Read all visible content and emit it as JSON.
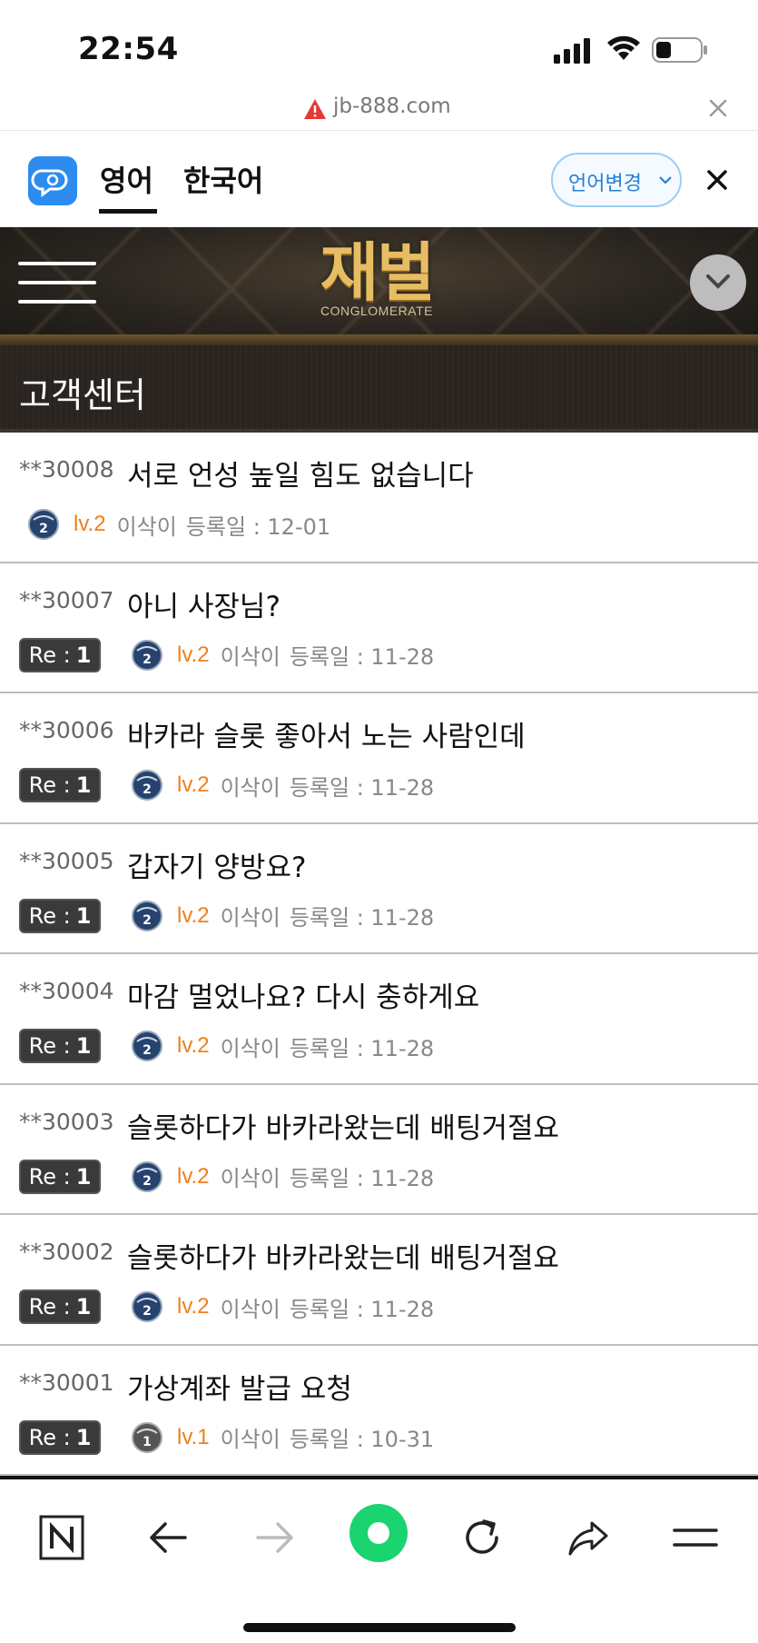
{
  "status_bar": {
    "time": "22:54"
  },
  "url_bar": {
    "domain": "jb-888.com"
  },
  "translate_bar": {
    "tab_active": "영어",
    "tab_inactive": "한국어",
    "change_language": "언어변경"
  },
  "header": {
    "logo_title": "재벌",
    "logo_subtitle": "CONGLOMERATE"
  },
  "page": {
    "title": "고객센터"
  },
  "posts": [
    {
      "id": "**30008",
      "title": "서로 언성 높일 힘도 없습니다",
      "reply": null,
      "level": "lv.2",
      "author": "이삭이",
      "date": "등록일 : 12-01"
    },
    {
      "id": "**30007",
      "title": "아니 사장님?",
      "reply_label": "Re :",
      "reply_count": "1",
      "level": "lv.2",
      "author": "이삭이",
      "date": "등록일 : 11-28"
    },
    {
      "id": "**30006",
      "title": "바카라 슬롯 좋아서 노는 사람인데",
      "reply_label": "Re :",
      "reply_count": "1",
      "level": "lv.2",
      "author": "이삭이",
      "date": "등록일 : 11-28"
    },
    {
      "id": "**30005",
      "title": "갑자기 양방요?",
      "reply_label": "Re :",
      "reply_count": "1",
      "level": "lv.2",
      "author": "이삭이",
      "date": "등록일 : 11-28"
    },
    {
      "id": "**30004",
      "title": "마감 멀었나요? 다시 충하게요",
      "reply_label": "Re :",
      "reply_count": "1",
      "level": "lv.2",
      "author": "이삭이",
      "date": "등록일 : 11-28"
    },
    {
      "id": "**30003",
      "title": "슬롯하다가 바카라왔는데 배팅거절요",
      "reply_label": "Re :",
      "reply_count": "1",
      "level": "lv.2",
      "author": "이삭이",
      "date": "등록일 : 11-28"
    },
    {
      "id": "**30002",
      "title": "슬롯하다가 바카라왔는데 배팅거절요",
      "reply_label": "Re :",
      "reply_count": "1",
      "level": "lv.2",
      "author": "이삭이",
      "date": "등록일 : 11-28"
    },
    {
      "id": "**30001",
      "title": "가상계좌 발급 요청",
      "reply_label": "Re :",
      "reply_count": "1",
      "level": "lv.1",
      "author": "이삭이",
      "date": "등록일 : 10-31"
    }
  ],
  "colors": {
    "level_text": "#ef7f1a",
    "accent_blue": "#2a7fd4",
    "header_gold": "#e7bd63",
    "toolbar_green": "#19d46f"
  },
  "toolbar_icons": [
    "naver-n-icon",
    "back-arrow-icon",
    "forward-arrow-icon",
    "green-circle-icon",
    "reload-icon",
    "share-icon",
    "menu-icon"
  ]
}
